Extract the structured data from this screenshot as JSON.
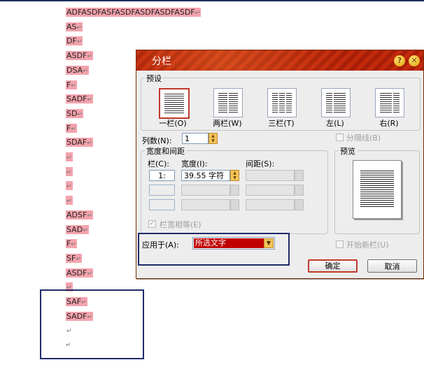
{
  "document": {
    "lines": [
      {
        "text": "ADFASDFASFASDFASDFASDFASDF",
        "mark": "↵"
      },
      {
        "text": "AS",
        "mark": "↵"
      },
      {
        "text": "DF",
        "mark": "↵"
      },
      {
        "text": "ASDF",
        "mark": "↵"
      },
      {
        "text": "DSA",
        "mark": "↵"
      },
      {
        "text": "F",
        "mark": "↵"
      },
      {
        "text": "SADF",
        "mark": "↵"
      },
      {
        "text": "SD",
        "mark": "↵"
      },
      {
        "text": "F",
        "mark": "↵"
      },
      {
        "text": "SDAF",
        "mark": "↵"
      },
      {
        "text": "",
        "mark": "↵"
      },
      {
        "text": "",
        "mark": "↵"
      },
      {
        "text": "",
        "mark": "↵"
      },
      {
        "text": "",
        "mark": "↵"
      },
      {
        "text": "ADSF",
        "mark": "↵"
      },
      {
        "text": "SAD",
        "mark": "↵"
      },
      {
        "text": "F",
        "mark": "↵"
      },
      {
        "text": "SF",
        "mark": "↵"
      },
      {
        "text": "ASDF",
        "mark": "↵"
      },
      {
        "text": "",
        "mark": "↵"
      },
      {
        "text": "SAF",
        "mark": "↵"
      },
      {
        "text": "SADF",
        "mark": "↵"
      },
      {
        "text": "",
        "mark": "↵"
      }
    ],
    "final_mark": "↵"
  },
  "dialog": {
    "title": "分栏",
    "help_glyph": "?",
    "close_glyph": "✕",
    "preset_group": "预设",
    "presets": [
      {
        "label": "一栏(O)",
        "selected": true
      },
      {
        "label": "两栏(W)",
        "selected": false
      },
      {
        "label": "三栏(T)",
        "selected": false
      },
      {
        "label": "左(L)",
        "selected": false
      },
      {
        "label": "右(R)",
        "selected": false
      }
    ],
    "col_count_label": "列数(N):",
    "col_count_value": "1",
    "separator_label": "分隔线(B)",
    "width_group": "宽度和间距",
    "col_header": "栏(C):",
    "width_header": "宽度(I):",
    "spacing_header": "间距(S):",
    "rows": [
      {
        "num": "1:",
        "width": "39.55 字符"
      },
      {
        "num": "",
        "width": ""
      },
      {
        "num": "",
        "width": ""
      }
    ],
    "equal_width_label": "栏宽相等(E)",
    "preview_label": "预览",
    "apply_label": "应用于(A):",
    "apply_value": "所选文字",
    "new_column_label": "开始新栏(U)",
    "ok_label": "确定",
    "cancel_label": "取消"
  },
  "colors": {
    "highlight": "#f4a3ad",
    "title_bar": "#c22a0c",
    "annotation_box": "#1f2b6a",
    "selection": "#c00000"
  }
}
